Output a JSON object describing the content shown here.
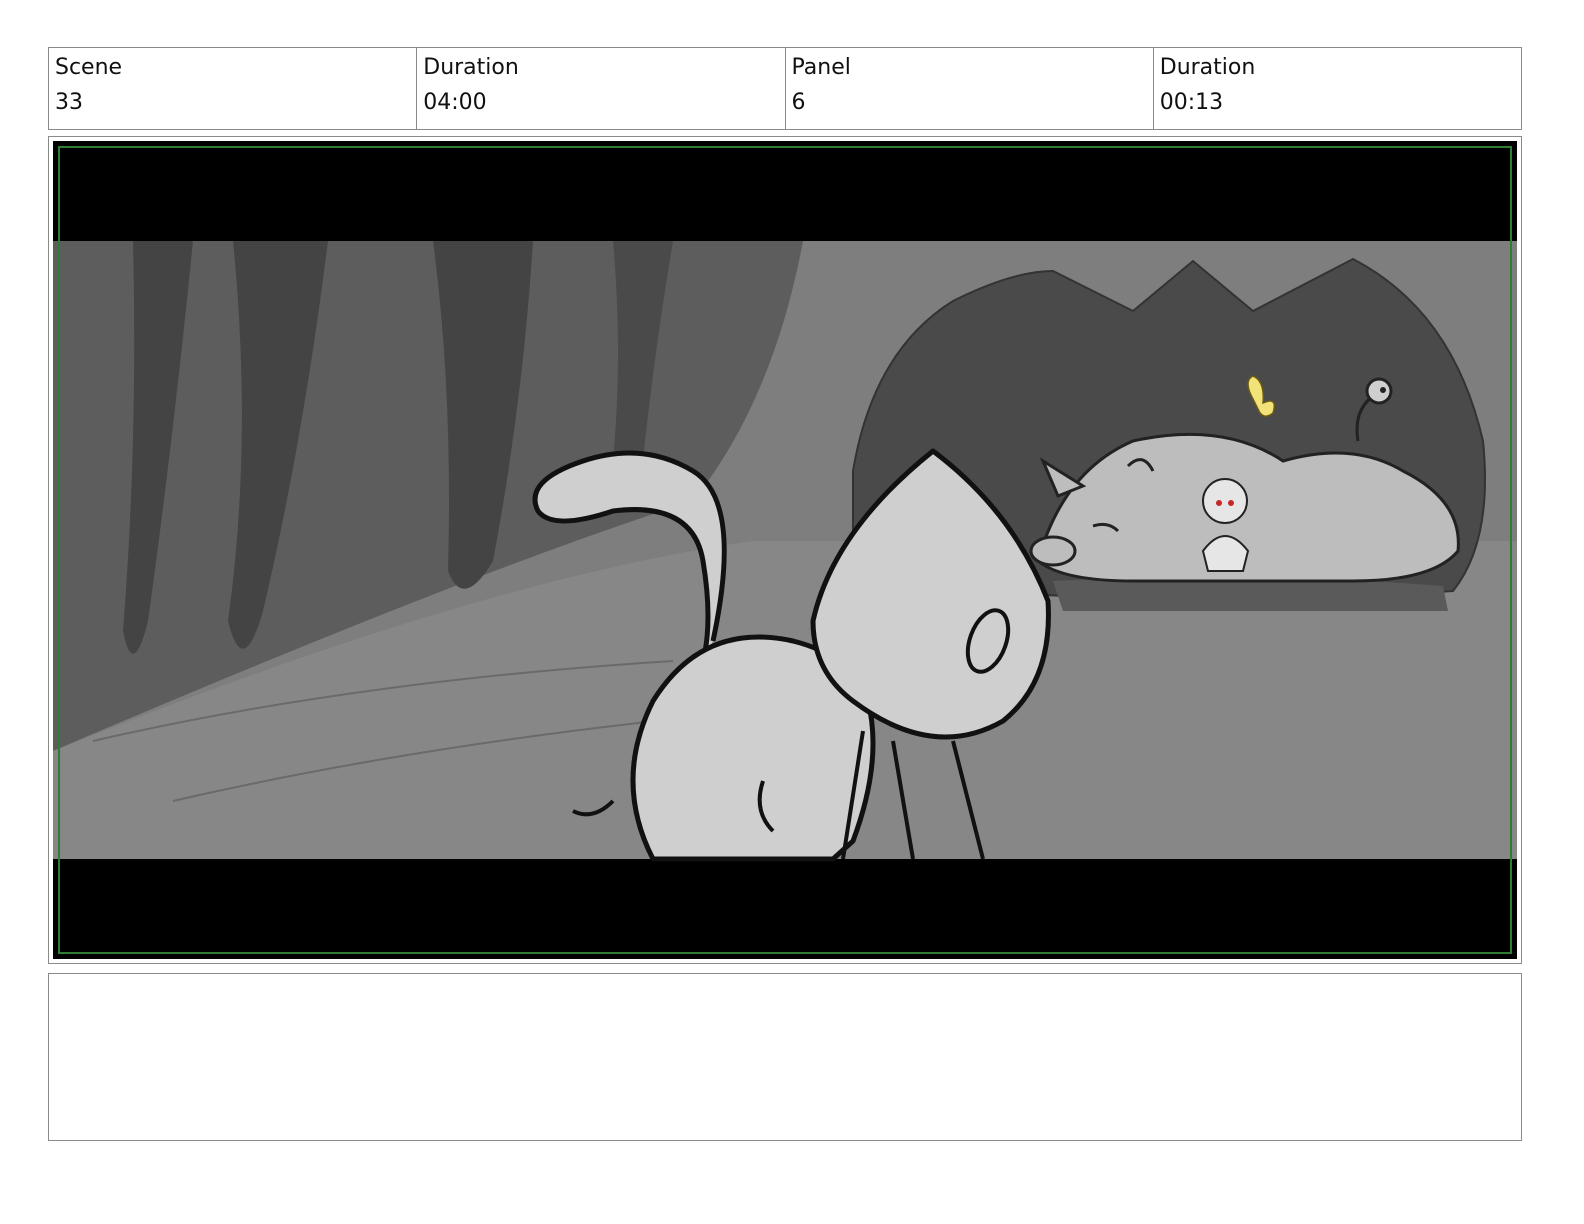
{
  "header": {
    "scene_label": "Scene",
    "scene_value": "33",
    "scene_duration_label": "Duration",
    "scene_duration_value": "04:00",
    "panel_label": "Panel",
    "panel_value": "6",
    "panel_duration_label": "Duration",
    "panel_duration_value": "00:13"
  },
  "notes": {
    "text": ""
  },
  "colors": {
    "frame_safe_line": "#2e7d32",
    "letterbox": "#000000",
    "butterfly": "#f2e27a"
  }
}
